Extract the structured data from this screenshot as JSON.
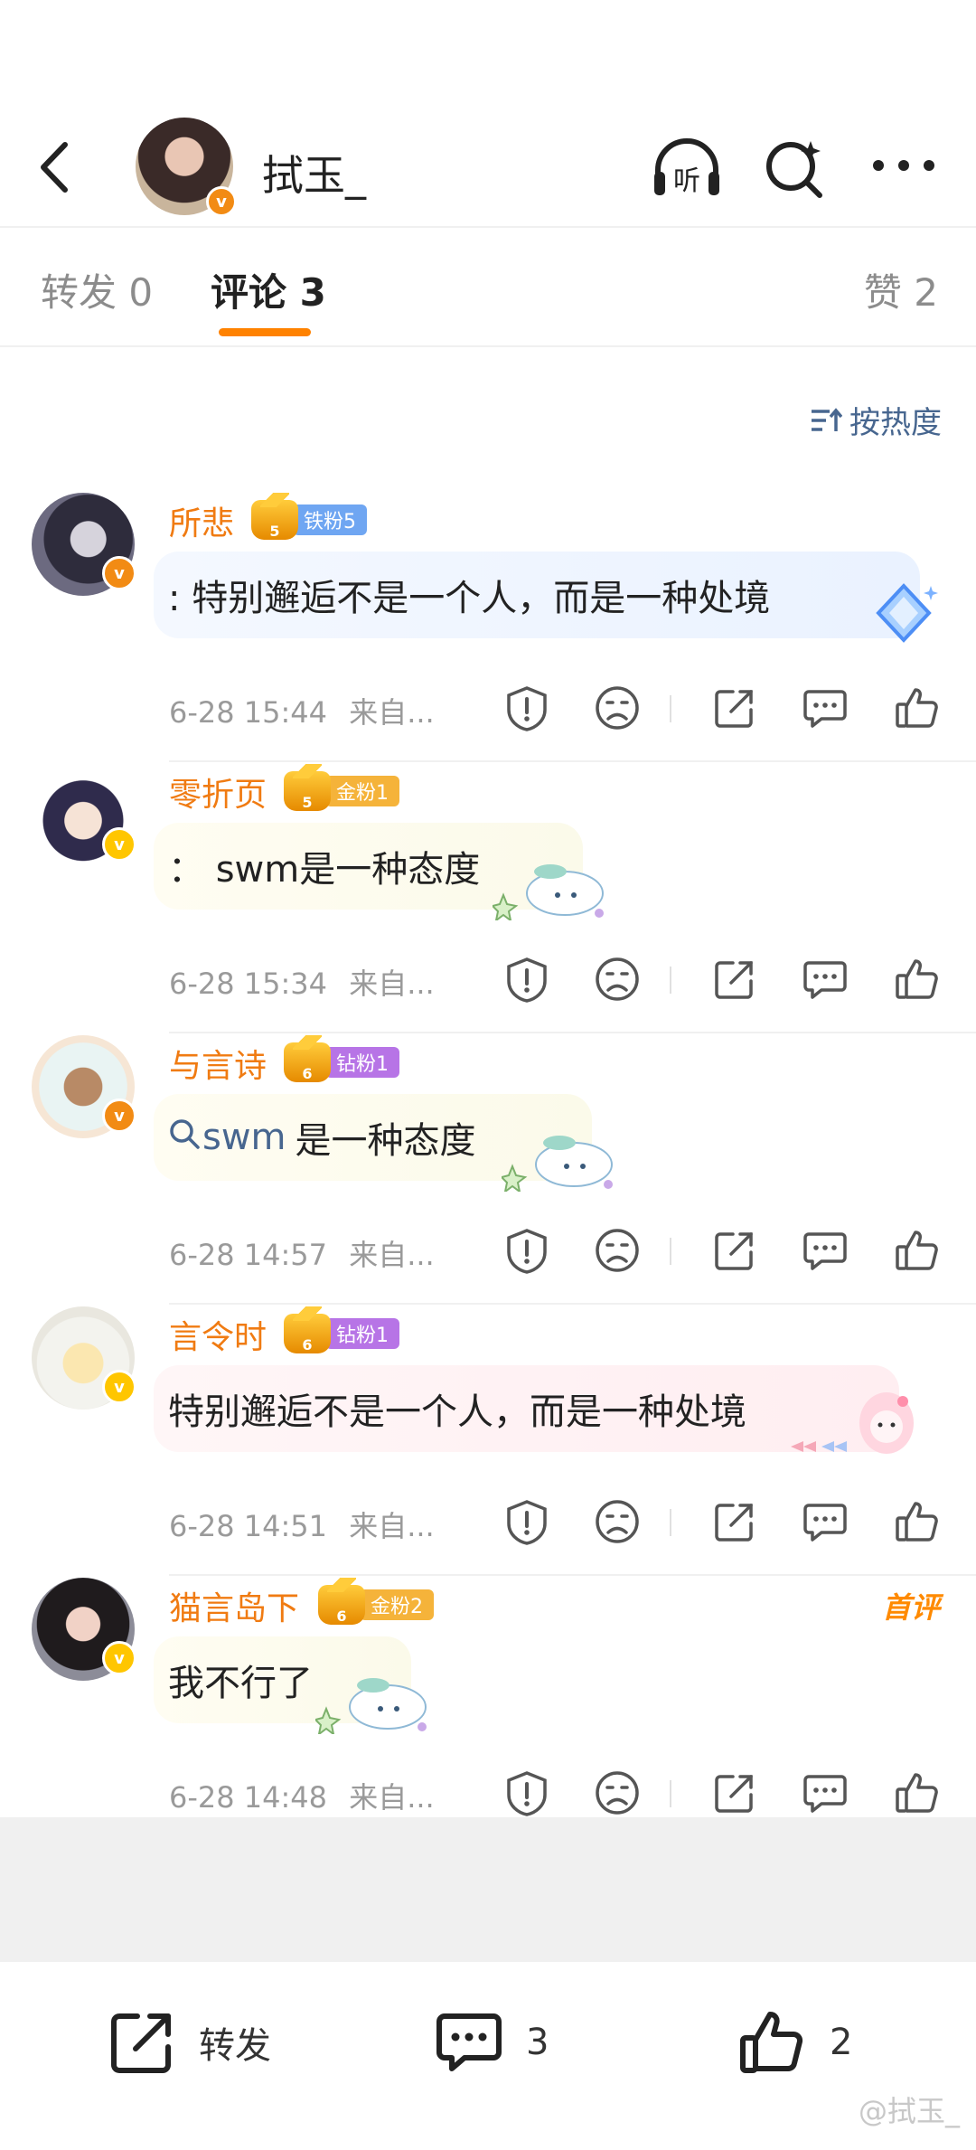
{
  "header": {
    "name": "拭玉_",
    "listen_label": "听"
  },
  "tabs": [
    {
      "label": "转发 0"
    },
    {
      "label": "评论 3"
    },
    {
      "label": "赞 2"
    }
  ],
  "sort_label": "按热度",
  "comments": [
    {
      "name": "所悲",
      "crown_level": "5",
      "fan_tag": "铁粉5",
      "text": ": 特别邂逅不是一个人，而是一种处境",
      "time": "6-28 15:44",
      "source": "来自..."
    },
    {
      "name": "零折页",
      "crown_level": "5",
      "fan_tag": "金粉1",
      "text": "：  swm是一种态度",
      "time": "6-28 15:34",
      "source": "来自..."
    },
    {
      "name": "与言诗",
      "crown_level": "6",
      "fan_tag": "钻粉1",
      "topic": "swm",
      "text": "是一种态度",
      "time": "6-28 14:57",
      "source": "来自..."
    },
    {
      "name": "言令时",
      "crown_level": "6",
      "fan_tag": "钻粉1",
      "text": "特别邂逅不是一个人，而是一种处境",
      "time": "6-28 14:51",
      "source": "来自..."
    },
    {
      "name": "猫言岛下",
      "crown_level": "6",
      "fan_tag": "金粉2",
      "first_label": "首评",
      "text": "我不行了",
      "time": "6-28 14:48",
      "source": "来自..."
    }
  ],
  "bottom_bar": {
    "repost_label": "转发",
    "comment_count": "3",
    "like_count": "2"
  },
  "watermark": "@拭玉_",
  "colors": {
    "accent": "#ff8200",
    "name": "#f07b12",
    "link": "#47668f",
    "muted": "#9a9a9a"
  }
}
